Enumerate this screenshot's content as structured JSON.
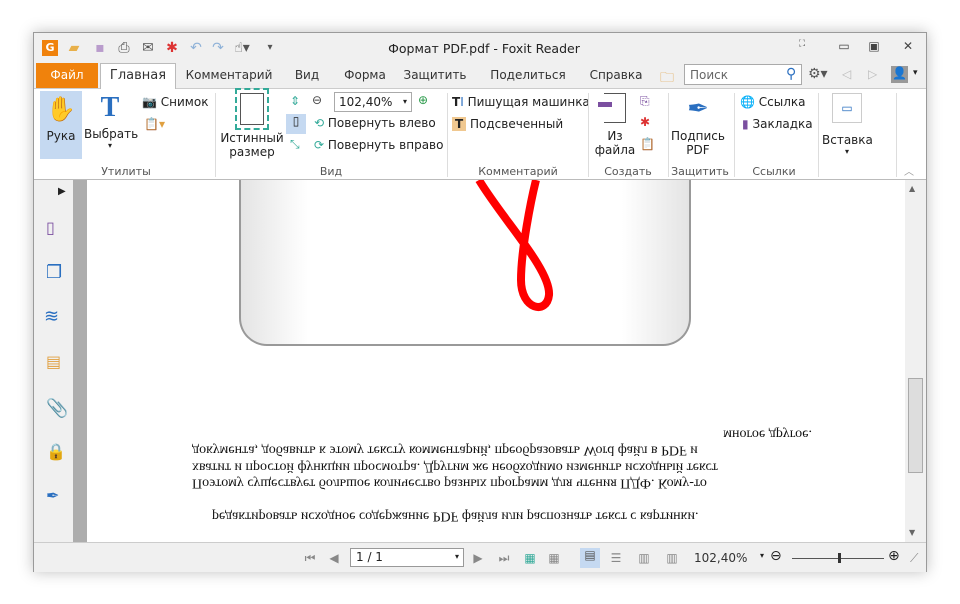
{
  "window": {
    "title": "Формат PDF.pdf - Foxit Reader"
  },
  "tabs": [
    "Файл",
    "Главная",
    "Комментарий",
    "Вид",
    "Форма",
    "Защитить",
    "Поделиться",
    "Справка"
  ],
  "search": {
    "placeholder": "Поиск"
  },
  "ribbon": {
    "utilities": {
      "group": "Утилиты",
      "hand": "Рука",
      "select": "Выбрать",
      "snapshot": "Снимок"
    },
    "view": {
      "group": "Вид",
      "actual_size_1": "Истинный",
      "actual_size_2": "размер",
      "zoom": "102,40%",
      "rotate_left": "Повернуть влево",
      "rotate_right": "Повернуть вправо"
    },
    "comment": {
      "group": "Комментарий",
      "typewriter": "Пишущая машинка",
      "highlight": "Подсвеченный"
    },
    "create": {
      "group": "Создать",
      "from_file_1": "Из",
      "from_file_2": "файла"
    },
    "protect": {
      "group": "Защитить",
      "sign_1": "Подпись",
      "sign_2": "PDF"
    },
    "links": {
      "group": "Ссылки",
      "link": "Ссылка",
      "bookmark": "Закладка"
    },
    "insert": {
      "label": "Вставка"
    }
  },
  "document": {
    "lines": [
      "редактировать исходное содержание PDF файла или распознать текст с картинки.",
      "Поэтому существует большое количество разных программ для чтения ПДФ. Кому-то",
      "хватит и простой функции просмотра. Другим же необходимо изменить исходный текст",
      "документа, добавить к этому тексту комментарий, преобразовать Word файл в PDF и",
      "многое другое."
    ]
  },
  "status": {
    "page": "1 / 1",
    "zoom": "102,40%",
    "zoom_slider_percent": 50
  }
}
